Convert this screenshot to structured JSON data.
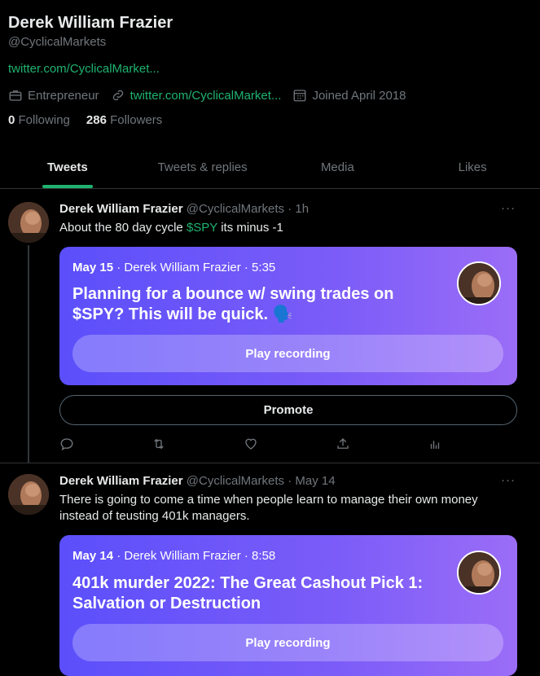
{
  "profile": {
    "name": "Derek William Frazier",
    "handle": "@CyclicalMarkets",
    "bio_link": "twitter.com/CyclicalMarket...",
    "category": "Entrepreneur",
    "website": "twitter.com/CyclicalMarket...",
    "joined": "Joined April 2018",
    "following_count": "0",
    "following_label": "Following",
    "followers_count": "286",
    "followers_label": "Followers"
  },
  "tabs": [
    {
      "label": "Tweets",
      "active": true
    },
    {
      "label": "Tweets & replies",
      "active": false
    },
    {
      "label": "Media",
      "active": false
    },
    {
      "label": "Likes",
      "active": false
    }
  ],
  "tweets": [
    {
      "author": "Derek William Frazier",
      "handle": "@CyclicalMarkets",
      "time": "· 1h",
      "text_before": "About the 80 day cycle ",
      "cashtag": "$SPY",
      "text_after": " its minus -1",
      "space": {
        "date": "May 15",
        "host": "· Derek William Frazier · 5:35",
        "title": "Planning for a bounce w/ swing trades on $SPY? This will be quick. 🗣️",
        "play_label": "Play recording"
      },
      "promote_label": "Promote"
    },
    {
      "author": "Derek William Frazier",
      "handle": "@CyclicalMarkets",
      "time": "· May 14",
      "text": "There is going to come a time when people learn to manage their own money instead of teusting 401k managers.",
      "space": {
        "date": "May 14",
        "host": "· Derek William Frazier · 8:58",
        "title": "401k murder 2022: The Great Cashout Pick 1: Salvation or Destruction",
        "play_label": "Play recording"
      }
    }
  ],
  "icons": {
    "more": "···",
    "category": "briefcase-icon",
    "website": "link-icon",
    "joined": "calendar-icon",
    "reply": "reply-icon",
    "retweet": "retweet-icon",
    "like": "heart-icon",
    "share": "share-icon",
    "analytics": "analytics-icon"
  },
  "colors": {
    "background": "#000000",
    "text": "#e7e9ea",
    "muted": "#71767b",
    "accent": "#1fb36f",
    "space_gradient_start": "#5b4ffb",
    "space_gradient_end": "#9b6df7"
  }
}
